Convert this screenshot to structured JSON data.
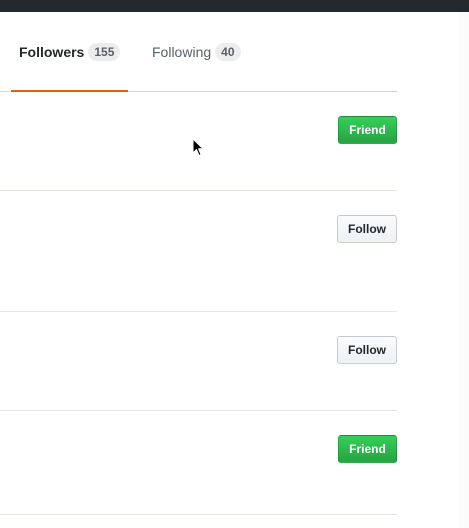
{
  "tabs": [
    {
      "label": "Followers",
      "count": "155"
    },
    {
      "label": "Following",
      "count": "40"
    }
  ],
  "users": [
    {
      "action": "Friend",
      "style": "friend"
    },
    {
      "action": "Follow",
      "style": "follow"
    },
    {
      "action": "Follow",
      "style": "follow"
    },
    {
      "action": "Friend",
      "style": "friend"
    }
  ],
  "colors": {
    "topbar": "#24292e",
    "active_tab_underline": "#e36209",
    "friend_button": "#28a745"
  }
}
